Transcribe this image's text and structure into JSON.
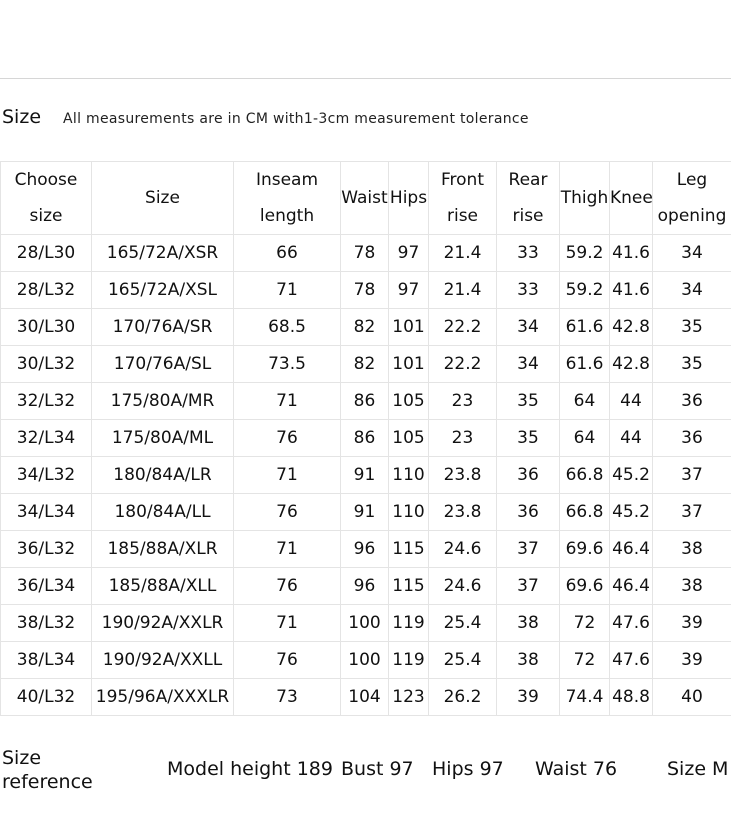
{
  "header": {
    "title": "Size",
    "note": "All measurements are in CM with1-3cm measurement tolerance"
  },
  "table": {
    "columns": [
      [
        "Choose",
        "size"
      ],
      [
        "Size"
      ],
      [
        "Inseam",
        "length"
      ],
      [
        "Waist"
      ],
      [
        "Hips"
      ],
      [
        "Front",
        "rise"
      ],
      [
        "Rear",
        "rise"
      ],
      [
        "Thigh"
      ],
      [
        "Knee"
      ],
      [
        "Leg",
        "opening"
      ]
    ],
    "rows": [
      [
        "28/L30",
        "165/72A/XSR",
        "66",
        "78",
        "97",
        "21.4",
        "33",
        "59.2",
        "41.6",
        "34"
      ],
      [
        "28/L32",
        "165/72A/XSL",
        "71",
        "78",
        "97",
        "21.4",
        "33",
        "59.2",
        "41.6",
        "34"
      ],
      [
        "30/L30",
        "170/76A/SR",
        "68.5",
        "82",
        "101",
        "22.2",
        "34",
        "61.6",
        "42.8",
        "35"
      ],
      [
        "30/L32",
        "170/76A/SL",
        "73.5",
        "82",
        "101",
        "22.2",
        "34",
        "61.6",
        "42.8",
        "35"
      ],
      [
        "32/L32",
        "175/80A/MR",
        "71",
        "86",
        "105",
        "23",
        "35",
        "64",
        "44",
        "36"
      ],
      [
        "32/L34",
        "175/80A/ML",
        "76",
        "86",
        "105",
        "23",
        "35",
        "64",
        "44",
        "36"
      ],
      [
        "34/L32",
        "180/84A/LR",
        "71",
        "91",
        "110",
        "23.8",
        "36",
        "66.8",
        "45.2",
        "37"
      ],
      [
        "34/L34",
        "180/84A/LL",
        "76",
        "91",
        "110",
        "23.8",
        "36",
        "66.8",
        "45.2",
        "37"
      ],
      [
        "36/L32",
        "185/88A/XLR",
        "71",
        "96",
        "115",
        "24.6",
        "37",
        "69.6",
        "46.4",
        "38"
      ],
      [
        "36/L34",
        "185/88A/XLL",
        "76",
        "96",
        "115",
        "24.6",
        "37",
        "69.6",
        "46.4",
        "38"
      ],
      [
        "38/L32",
        "190/92A/XXLR",
        "71",
        "100",
        "119",
        "25.4",
        "38",
        "72",
        "47.6",
        "39"
      ],
      [
        "38/L34",
        "190/92A/XXLL",
        "76",
        "100",
        "119",
        "25.4",
        "38",
        "72",
        "47.6",
        "39"
      ],
      [
        "40/L32",
        "195/96A/XXXLR",
        "73",
        "104",
        "123",
        "26.2",
        "39",
        "74.4",
        "48.8",
        "40"
      ]
    ]
  },
  "size_reference": {
    "label": "Size reference",
    "model_height": "Model height 189",
    "bust": "Bust 97",
    "hips": "Hips 97",
    "waist": "Waist 76",
    "size": "Size M"
  }
}
